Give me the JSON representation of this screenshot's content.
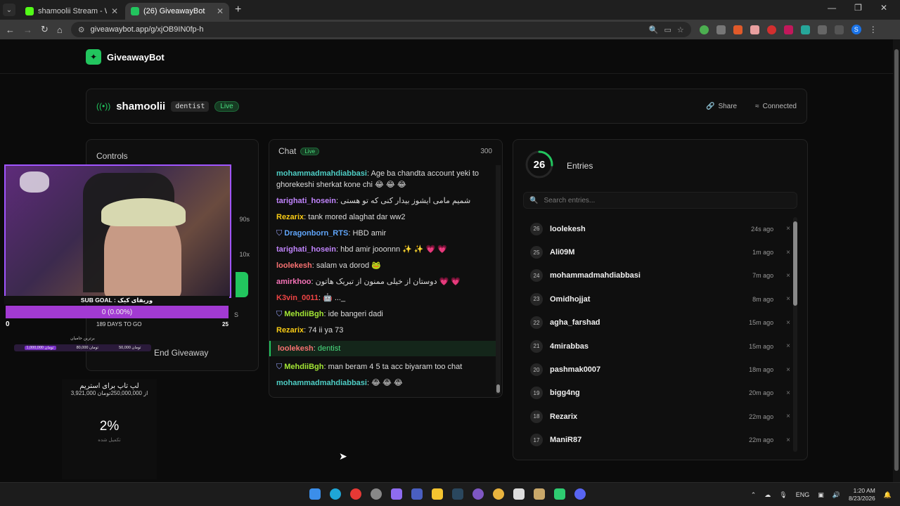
{
  "browser": {
    "tabs": [
      {
        "title": "shamoolii Stream - Watch Live o",
        "favicon_color": "#53fc18",
        "active": false
      },
      {
        "title": "(26) GiveawayBot",
        "favicon_color": "#22c55e",
        "active": true
      }
    ],
    "new_tab": "+",
    "url": "giveawaybot.app/g/xjOB9IN0fp-h",
    "profile_letter": "S"
  },
  "app": {
    "brand": "GiveawayBot",
    "streamer": {
      "name": "shamoolii",
      "keyword": "dentist",
      "live_label": "Live",
      "share_label": "Share",
      "connected_label": "Connected"
    },
    "controls": {
      "title": "Controls",
      "duration": "90s",
      "multiplier": "10x",
      "s_label": "S",
      "end_label": "End Giveaway"
    },
    "chat": {
      "title": "Chat",
      "live_label": "Live",
      "count": "300",
      "messages": [
        {
          "user": "mohammadmahdiabbasi",
          "color": "#4ecdc4",
          "text": "Age ba chandta account yeki to ghorekeshi sherkat kone chi 😂 😂 😂",
          "mod": false,
          "highlight": false
        },
        {
          "user": "tarighati_hosein",
          "color": "#c084fc",
          "text": "شمیم مامی ایشوز بیدار کنی که تو هستی",
          "mod": false,
          "highlight": false
        },
        {
          "user": "Rezarix",
          "color": "#facc15",
          "text": "tank mored alaghat dar ww2",
          "mod": false,
          "highlight": false
        },
        {
          "user": "Dragonborn_RTS",
          "color": "#60a5fa",
          "text": "HBD amir",
          "mod": true,
          "highlight": false
        },
        {
          "user": "tarighati_hosein",
          "color": "#c084fc",
          "text": "hbd amir jooonnn ✨ ✨ 💗 💗",
          "mod": false,
          "highlight": false
        },
        {
          "user": "loolekesh",
          "color": "#f87171",
          "text": "salam va dorod 🐸",
          "mod": false,
          "highlight": false
        },
        {
          "user": "amirkhoo",
          "color": "#f472b6",
          "text": "دوستان از خیلی ممنون از تبریک هاتون 💗 💗",
          "mod": false,
          "highlight": false
        },
        {
          "user": "K3vin_0011",
          "color": "#ef4444",
          "text": "🤖 ..._",
          "mod": false,
          "highlight": false
        },
        {
          "user": "MehdiiBgh",
          "color": "#a3e635",
          "text": "ide bangeri dadi",
          "mod": true,
          "highlight": false
        },
        {
          "user": "Rezarix",
          "color": "#facc15",
          "text": "74 ii ya 73",
          "mod": false,
          "highlight": false
        },
        {
          "user": "loolekesh",
          "color": "#f87171",
          "text": "dentist",
          "mod": false,
          "highlight": true
        },
        {
          "user": "MehdiiBgh",
          "color": "#a3e635",
          "text": "man beram 4 5 ta acc biyaram too chat",
          "mod": true,
          "highlight": false
        },
        {
          "user": "mohammadmahdiabbasi",
          "color": "#4ecdc4",
          "text": "😂 😂 😂",
          "mod": false,
          "highlight": false
        }
      ]
    },
    "entries": {
      "count": "26",
      "progress": 0.26,
      "title": "Entries",
      "search_placeholder": "Search entries...",
      "list": [
        {
          "num": "26",
          "name": "loolekesh",
          "ago": "24s ago"
        },
        {
          "num": "25",
          "name": "Ali09M",
          "ago": "1m ago"
        },
        {
          "num": "24",
          "name": "mohammadmahdiabbasi",
          "ago": "7m ago"
        },
        {
          "num": "23",
          "name": "Omidhojjat",
          "ago": "8m ago"
        },
        {
          "num": "22",
          "name": "agha_farshad",
          "ago": "15m ago"
        },
        {
          "num": "21",
          "name": "4mirabbas",
          "ago": "15m ago"
        },
        {
          "num": "20",
          "name": "pashmak0007",
          "ago": "18m ago"
        },
        {
          "num": "19",
          "name": "bigg4ng",
          "ago": "20m ago"
        },
        {
          "num": "18",
          "name": "Rezarix",
          "ago": "22m ago"
        },
        {
          "num": "17",
          "name": "ManiR87",
          "ago": "22m ago"
        }
      ],
      "remove_glyph": "×"
    }
  },
  "overlay": {
    "sub_goal": "SUB GOAL : وریفای کیک",
    "sub_progress": "0 (0.00%)",
    "sub_min": "0",
    "sub_max": "25",
    "days_left": "189 DAYS TO GO",
    "donors_title": "برترین حامیان",
    "donor_amounts": [
      "1,000,000 تومان",
      "80,000 تومان",
      "50,000 تومان"
    ],
    "goal_title": "لپ تاپ برای استریم",
    "goal_sub": "3,921,000 از 250,000,000تومان",
    "goal_pct": "2%",
    "goal_done": "تکمیل شده"
  },
  "taskbar": {
    "lang": "ENG",
    "time": "1:20 AM",
    "date": "8/23/2026"
  }
}
